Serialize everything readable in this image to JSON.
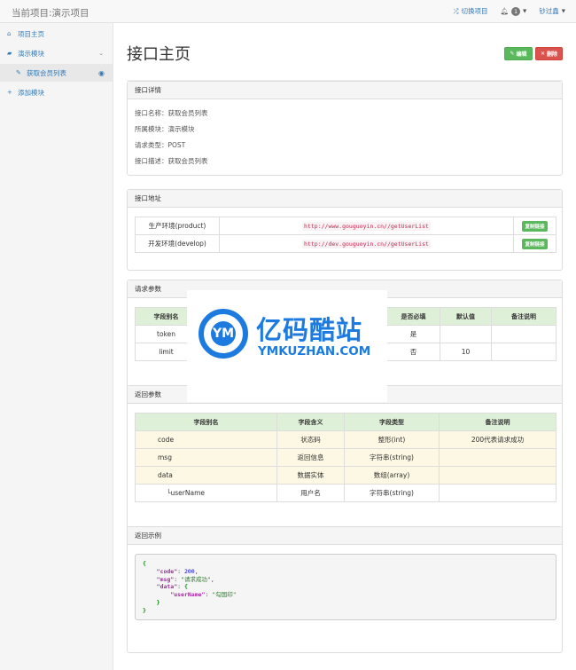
{
  "navbar": {
    "brand": "当前项目:演示项目",
    "switch_project": "切换项目",
    "notifications_count": "1",
    "user_name": "钞过鑫"
  },
  "sidebar": {
    "items": [
      {
        "label": "项目主页",
        "icon": "home-icon"
      },
      {
        "label": "演示模块",
        "icon": "folder-open-icon"
      },
      {
        "label": "获取会员列表",
        "icon": "edit-icon"
      },
      {
        "label": "添加模块",
        "icon": "plus-icon"
      }
    ]
  },
  "page": {
    "title": "接口主页",
    "edit_label": "编辑",
    "delete_label": "删除"
  },
  "details": {
    "heading": "接口详情",
    "name": "接口名称：获取会员列表",
    "module": "所属模块：演示模块",
    "method": "请求类型：POST",
    "desc": "接口描述：获取会员列表"
  },
  "address": {
    "heading": "接口地址",
    "rows": [
      {
        "env": "生产环境(product)",
        "url": "http://www.gouguoyin.cn//getUserList",
        "copy": "复制链接"
      },
      {
        "env": "开发环境(develop)",
        "url": "http://dev.gouguoyin.cn//getUserList",
        "copy": "复制链接"
      }
    ]
  },
  "request": {
    "heading": "请求参数",
    "headers": [
      "字段别名",
      "是否必填",
      "默认值",
      "备注说明"
    ],
    "rows": [
      {
        "alias": "token",
        "required": "是",
        "default": "",
        "note": ""
      },
      {
        "alias": "limit",
        "required": "否",
        "default": "10",
        "note": ""
      }
    ]
  },
  "response": {
    "heading": "返回参数",
    "headers": [
      "字段别名",
      "字段含义",
      "字段类型",
      "备注说明"
    ],
    "rows": [
      {
        "alias": "code",
        "meaning": "状态码",
        "type": "整形(int)",
        "note": "200代表请求成功"
      },
      {
        "alias": "msg",
        "meaning": "返回信息",
        "type": "字符串(string)",
        "note": ""
      },
      {
        "alias": "data",
        "meaning": "数据实体",
        "type": "数组(array)",
        "note": ""
      },
      {
        "alias": "└userName",
        "meaning": "用户名",
        "type": "字符串(string)",
        "note": ""
      }
    ]
  },
  "example": {
    "heading": "返回示例",
    "code_key": "\"code\"",
    "code_val": "200",
    "msg_key": "\"msg\"",
    "msg_val": "\"请求成功\"",
    "data_key": "\"data\"",
    "username_key": "\"userName\"",
    "username_val": "\"勾国印\""
  },
  "watermark": {
    "cn": "亿码酷站",
    "en": "YMKUZHAN.COM",
    "logo_text": "YM"
  }
}
